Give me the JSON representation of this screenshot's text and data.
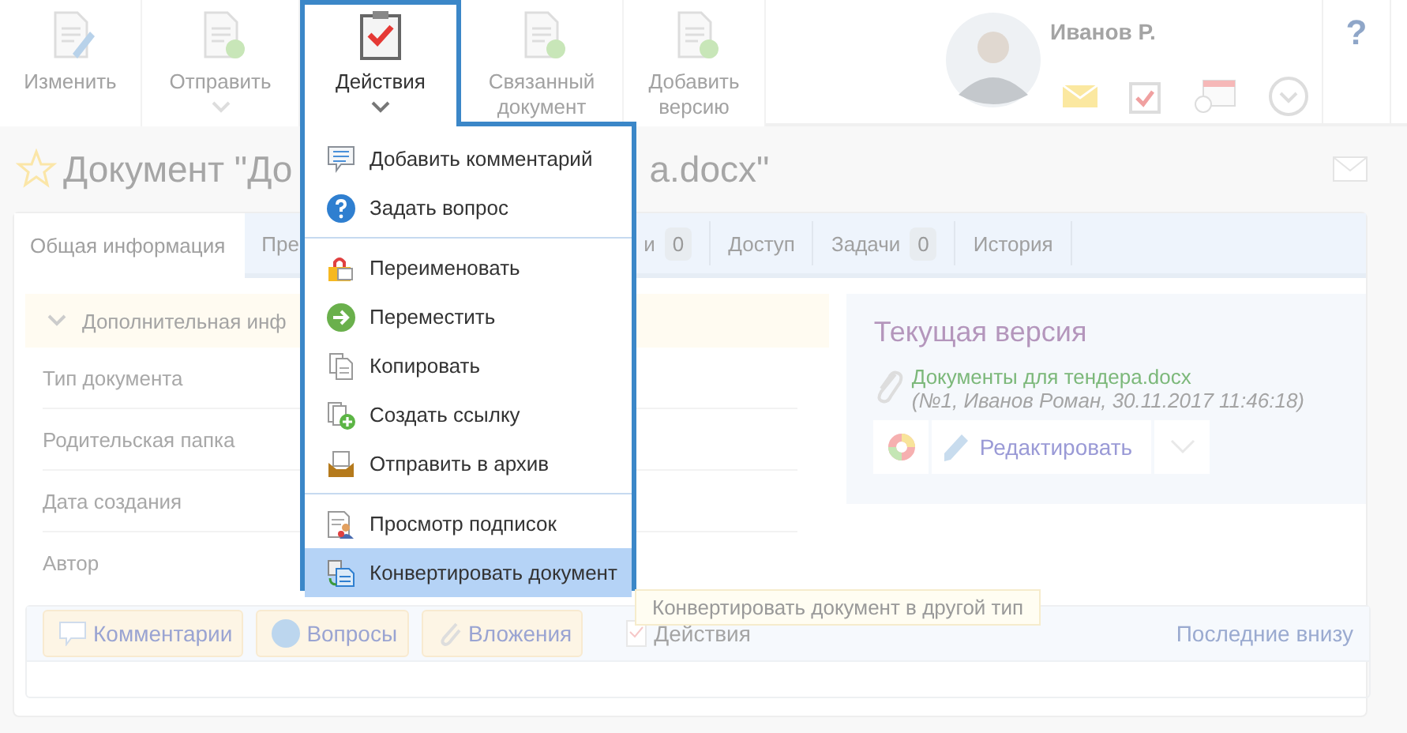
{
  "toolbar": {
    "buttons": [
      {
        "label": "Изменить",
        "expanded": false,
        "dropdown": false
      },
      {
        "label": "Отправить",
        "expanded": false,
        "dropdown": true
      },
      {
        "label": "Действия",
        "expanded": true,
        "dropdown": true
      },
      {
        "label": "Связанный документ",
        "expanded": false,
        "dropdown": false
      },
      {
        "label": "Добавить версию",
        "expanded": false,
        "dropdown": false
      }
    ]
  },
  "user": {
    "name": "Иванов Р.",
    "help": "?"
  },
  "title": {
    "visible_start": "Документ \"До",
    "visible_end": "а.docx\""
  },
  "tabs": [
    {
      "label": "Общая информация",
      "selected": true
    },
    {
      "label": "Пре",
      "selected": false
    },
    {
      "label": "и",
      "count": "0",
      "selected": false
    },
    {
      "label": "Доступ",
      "selected": false
    },
    {
      "label": "Задачи",
      "count": "0",
      "selected": false
    },
    {
      "label": "История",
      "selected": false
    }
  ],
  "section": {
    "title": "Дополнительная инф",
    "expanded": true
  },
  "fields": [
    "Тип документа",
    "Родительская папка",
    "Дата создания",
    "Автор"
  ],
  "version": {
    "title": "Текущая версия",
    "file": "Документы для тендера.docx",
    "meta": "(№1, Иванов Роман, 30.11.2017 11:46:18)",
    "edit": "Редактировать"
  },
  "discussion": {
    "tabs": [
      {
        "label": "Комментарии",
        "kind": "button"
      },
      {
        "label": "Вопросы",
        "kind": "button"
      },
      {
        "label": "Вложения",
        "kind": "button"
      },
      {
        "label": "Действия",
        "kind": "link"
      }
    ],
    "order": "Последние внизу"
  },
  "menu": {
    "groups": [
      [
        {
          "label": "Добавить комментарий",
          "selected": false
        },
        {
          "label": "Задать вопрос",
          "selected": false
        }
      ],
      [
        {
          "label": "Переименовать",
          "selected": false
        },
        {
          "label": "Переместить",
          "selected": false
        },
        {
          "label": "Копировать",
          "selected": false
        },
        {
          "label": "Создать ссылку",
          "selected": false
        },
        {
          "label": "Отправить в архив",
          "selected": false
        }
      ],
      [
        {
          "label": "Просмотр подписок",
          "selected": false
        },
        {
          "label": "Конвертировать документ",
          "selected": true
        }
      ]
    ]
  },
  "tooltip": "Конвертировать документ в другой тип"
}
